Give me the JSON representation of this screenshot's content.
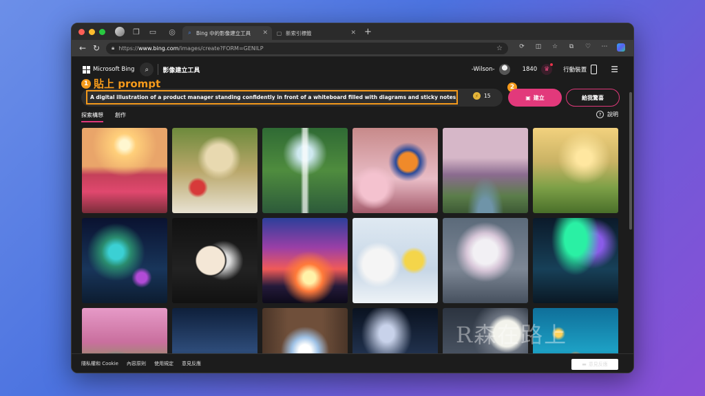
{
  "browser": {
    "tabs": [
      {
        "label": "Bing 中的影像建立工具",
        "active": true
      },
      {
        "label": "新索引標籤",
        "active": false
      }
    ],
    "url_prefix": "https://",
    "url_host": "www.bing.com",
    "url_path": "/images/create?FORM=GENILP"
  },
  "header": {
    "brand": "Microsoft Bing",
    "tool_title": "影像建立工具",
    "user_name": "-Wilson-",
    "points": "1840",
    "mobile_label": "行動裝置"
  },
  "annotations": {
    "step1_num": "1",
    "step1_text": "貼上 prompt",
    "step2_num": "2"
  },
  "prompt": {
    "text": "A digital illustration of a product manager standing confidently in front of a whiteboard filled with diagrams and sticky notes, showc",
    "boosts": "15",
    "create_label": "建立",
    "surprise_label": "給我驚喜"
  },
  "page_tabs": [
    {
      "label": "探索構想",
      "active": true
    },
    {
      "label": "創作",
      "active": false
    }
  ],
  "help_label": "說明",
  "gallery": [
    {
      "name": "tulip-field-sunset"
    },
    {
      "name": "picnic-basket-flowers"
    },
    {
      "name": "waterfall-rainbow"
    },
    {
      "name": "butterfly-cherry-blossom"
    },
    {
      "name": "cherry-blossom-river"
    },
    {
      "name": "kite-park"
    },
    {
      "name": "glowing-fantasy-tree"
    },
    {
      "name": "crescent-moon-flowers"
    },
    {
      "name": "horse-rider-sunset"
    },
    {
      "name": "polar-bears-lemonade"
    },
    {
      "name": "white-flower-bouquet"
    },
    {
      "name": "aurora-lake"
    },
    {
      "name": "pink-garden-peacock"
    },
    {
      "name": "night-city-skyline"
    },
    {
      "name": "library-light"
    },
    {
      "name": "milky-way-mountains"
    },
    {
      "name": "polar-bear-moon"
    },
    {
      "name": "underwater-coral"
    }
  ],
  "watermark": "R森在路上",
  "footer": {
    "links": [
      "隱私權和 Cookie",
      "內容原則",
      "使用規定",
      "意見反應"
    ],
    "feedback_button": "意見反應"
  },
  "colors": {
    "accent": "#e2397b",
    "annotation": "#f59a1b"
  }
}
